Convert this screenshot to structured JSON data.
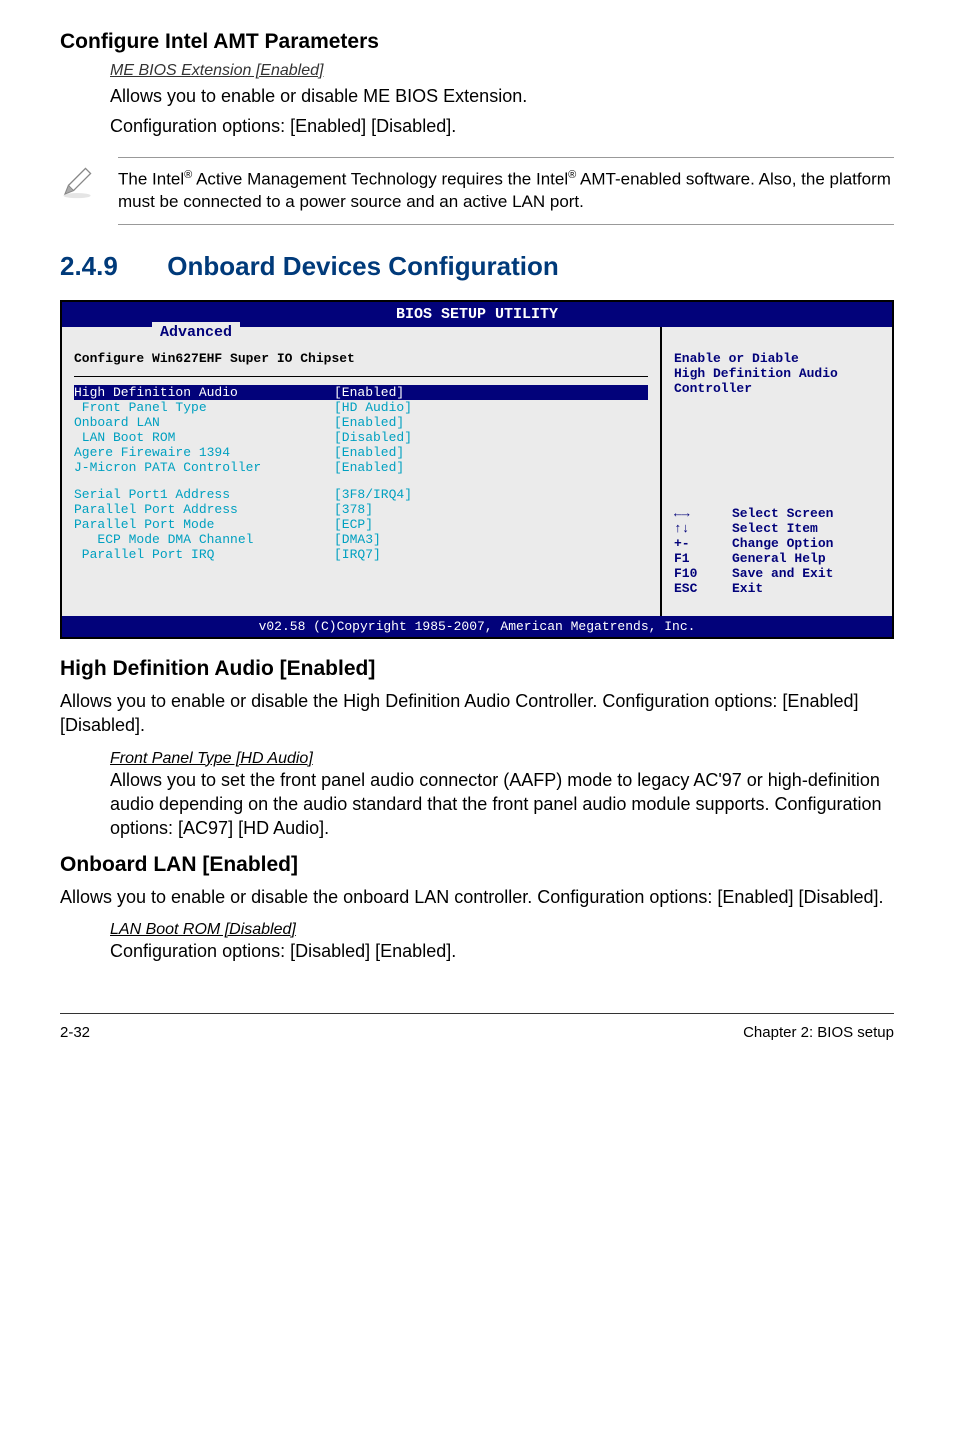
{
  "section1": {
    "heading": "Configure Intel AMT Parameters",
    "sub": "ME BIOS Extension [Enabled]",
    "p1": "Allows you to enable or disable ME BIOS Extension.",
    "p2": "Configuration options: [Enabled] [Disabled]."
  },
  "note": {
    "pre": "The Intel",
    "mid": " Active Management Technology requires the Intel",
    "post": " AMT-enabled software. Also, the platform must be connected to a power source and an active LAN port.",
    "reg1": "®",
    "reg2": "®"
  },
  "main": {
    "num": "2.4.9",
    "title": "Onboard Devices Configuration"
  },
  "bios": {
    "title": "BIOS SETUP UTILITY",
    "tab": "Advanced",
    "chipset": "Configure Win627EHF Super IO Chipset",
    "rows_a": [
      {
        "label": "High Definition Audio",
        "val": "[Enabled]",
        "hl": true
      },
      {
        "label": " Front Panel Type",
        "val": "[HD Audio]"
      },
      {
        "label": "Onboard LAN",
        "val": "[Enabled]"
      },
      {
        "label": " LAN Boot ROM",
        "val": "[Disabled]"
      },
      {
        "label": "Agere Firewaire 1394",
        "val": "[Enabled]"
      },
      {
        "label": "J-Micron PATA Controller",
        "val": "[Enabled]"
      }
    ],
    "rows_b": [
      {
        "label": "Serial Port1 Address",
        "val": "[3F8/IRQ4]"
      },
      {
        "label": "Parallel Port Address",
        "val": "[378]"
      },
      {
        "label": "Parallel Port Mode",
        "val": "[ECP]"
      },
      {
        "label": "   ECP Mode DMA Channel",
        "val": "[DMA3]"
      },
      {
        "label": " Parallel Port IRQ",
        "val": "[IRQ7]"
      }
    ],
    "right_top": [
      "Enable or Diable",
      "High Definition Audio",
      "Controller"
    ],
    "hints": [
      {
        "key": "←→",
        "text": "Select Screen"
      },
      {
        "key": "↑↓",
        "text": "Select Item"
      },
      {
        "key": "+-",
        "text": "Change Option"
      },
      {
        "key": "F1",
        "text": "General Help"
      },
      {
        "key": "F10",
        "text": "Save and Exit"
      },
      {
        "key": "ESC",
        "text": "Exit"
      }
    ],
    "footer": "v02.58 (C)Copyright 1985-2007, American Megatrends, Inc."
  },
  "hda": {
    "heading": "High Definition Audio [Enabled]",
    "p1": "Allows you to enable or disable the High Definition Audio Controller. Configuration options: [Enabled] [Disabled].",
    "sub": "Front Panel Type [HD Audio]",
    "p2": "Allows you to set the front panel audio connector (AAFP) mode to legacy AC'97 or high-definition audio depending on the audio standard that the front panel audio module supports. Configuration options: [AC97] [HD Audio]."
  },
  "lan": {
    "heading": "Onboard LAN [Enabled]",
    "p1": "Allows you to enable or disable the onboard LAN controller. Configuration options: [Enabled] [Disabled].",
    "sub": "LAN Boot ROM [Disabled]",
    "p2": "Configuration options: [Disabled] [Enabled]."
  },
  "footer": {
    "left": "2-32",
    "right": "Chapter 2: BIOS setup"
  }
}
